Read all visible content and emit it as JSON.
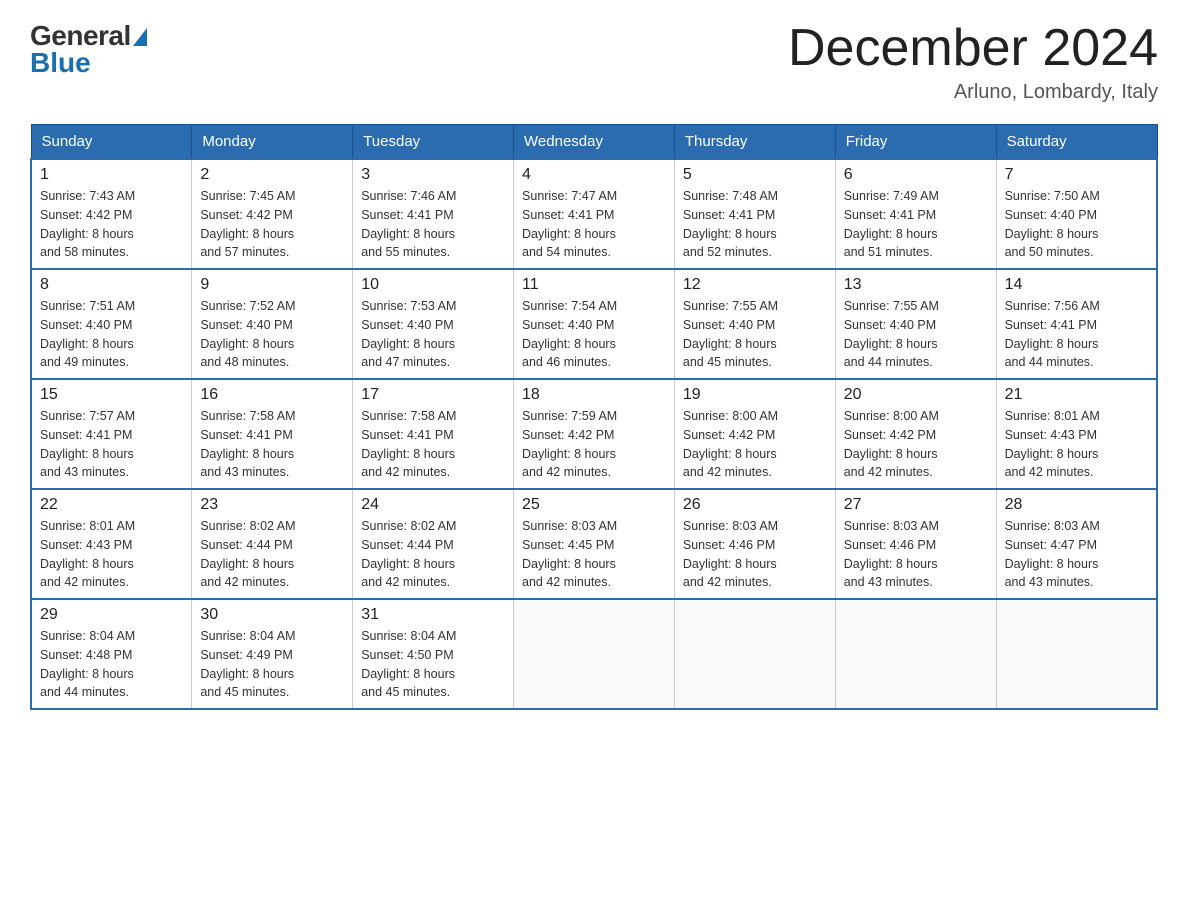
{
  "header": {
    "logo_general": "General",
    "logo_blue": "Blue",
    "month_title": "December 2024",
    "location": "Arluno, Lombardy, Italy"
  },
  "days_of_week": [
    "Sunday",
    "Monday",
    "Tuesday",
    "Wednesday",
    "Thursday",
    "Friday",
    "Saturday"
  ],
  "weeks": [
    [
      {
        "day": "1",
        "sunrise": "7:43 AM",
        "sunset": "4:42 PM",
        "daylight": "8 hours and 58 minutes."
      },
      {
        "day": "2",
        "sunrise": "7:45 AM",
        "sunset": "4:42 PM",
        "daylight": "8 hours and 57 minutes."
      },
      {
        "day": "3",
        "sunrise": "7:46 AM",
        "sunset": "4:41 PM",
        "daylight": "8 hours and 55 minutes."
      },
      {
        "day": "4",
        "sunrise": "7:47 AM",
        "sunset": "4:41 PM",
        "daylight": "8 hours and 54 minutes."
      },
      {
        "day": "5",
        "sunrise": "7:48 AM",
        "sunset": "4:41 PM",
        "daylight": "8 hours and 52 minutes."
      },
      {
        "day": "6",
        "sunrise": "7:49 AM",
        "sunset": "4:41 PM",
        "daylight": "8 hours and 51 minutes."
      },
      {
        "day": "7",
        "sunrise": "7:50 AM",
        "sunset": "4:40 PM",
        "daylight": "8 hours and 50 minutes."
      }
    ],
    [
      {
        "day": "8",
        "sunrise": "7:51 AM",
        "sunset": "4:40 PM",
        "daylight": "8 hours and 49 minutes."
      },
      {
        "day": "9",
        "sunrise": "7:52 AM",
        "sunset": "4:40 PM",
        "daylight": "8 hours and 48 minutes."
      },
      {
        "day": "10",
        "sunrise": "7:53 AM",
        "sunset": "4:40 PM",
        "daylight": "8 hours and 47 minutes."
      },
      {
        "day": "11",
        "sunrise": "7:54 AM",
        "sunset": "4:40 PM",
        "daylight": "8 hours and 46 minutes."
      },
      {
        "day": "12",
        "sunrise": "7:55 AM",
        "sunset": "4:40 PM",
        "daylight": "8 hours and 45 minutes."
      },
      {
        "day": "13",
        "sunrise": "7:55 AM",
        "sunset": "4:40 PM",
        "daylight": "8 hours and 44 minutes."
      },
      {
        "day": "14",
        "sunrise": "7:56 AM",
        "sunset": "4:41 PM",
        "daylight": "8 hours and 44 minutes."
      }
    ],
    [
      {
        "day": "15",
        "sunrise": "7:57 AM",
        "sunset": "4:41 PM",
        "daylight": "8 hours and 43 minutes."
      },
      {
        "day": "16",
        "sunrise": "7:58 AM",
        "sunset": "4:41 PM",
        "daylight": "8 hours and 43 minutes."
      },
      {
        "day": "17",
        "sunrise": "7:58 AM",
        "sunset": "4:41 PM",
        "daylight": "8 hours and 42 minutes."
      },
      {
        "day": "18",
        "sunrise": "7:59 AM",
        "sunset": "4:42 PM",
        "daylight": "8 hours and 42 minutes."
      },
      {
        "day": "19",
        "sunrise": "8:00 AM",
        "sunset": "4:42 PM",
        "daylight": "8 hours and 42 minutes."
      },
      {
        "day": "20",
        "sunrise": "8:00 AM",
        "sunset": "4:42 PM",
        "daylight": "8 hours and 42 minutes."
      },
      {
        "day": "21",
        "sunrise": "8:01 AM",
        "sunset": "4:43 PM",
        "daylight": "8 hours and 42 minutes."
      }
    ],
    [
      {
        "day": "22",
        "sunrise": "8:01 AM",
        "sunset": "4:43 PM",
        "daylight": "8 hours and 42 minutes."
      },
      {
        "day": "23",
        "sunrise": "8:02 AM",
        "sunset": "4:44 PM",
        "daylight": "8 hours and 42 minutes."
      },
      {
        "day": "24",
        "sunrise": "8:02 AM",
        "sunset": "4:44 PM",
        "daylight": "8 hours and 42 minutes."
      },
      {
        "day": "25",
        "sunrise": "8:03 AM",
        "sunset": "4:45 PM",
        "daylight": "8 hours and 42 minutes."
      },
      {
        "day": "26",
        "sunrise": "8:03 AM",
        "sunset": "4:46 PM",
        "daylight": "8 hours and 42 minutes."
      },
      {
        "day": "27",
        "sunrise": "8:03 AM",
        "sunset": "4:46 PM",
        "daylight": "8 hours and 43 minutes."
      },
      {
        "day": "28",
        "sunrise": "8:03 AM",
        "sunset": "4:47 PM",
        "daylight": "8 hours and 43 minutes."
      }
    ],
    [
      {
        "day": "29",
        "sunrise": "8:04 AM",
        "sunset": "4:48 PM",
        "daylight": "8 hours and 44 minutes."
      },
      {
        "day": "30",
        "sunrise": "8:04 AM",
        "sunset": "4:49 PM",
        "daylight": "8 hours and 45 minutes."
      },
      {
        "day": "31",
        "sunrise": "8:04 AM",
        "sunset": "4:50 PM",
        "daylight": "8 hours and 45 minutes."
      },
      null,
      null,
      null,
      null
    ]
  ],
  "labels": {
    "sunrise": "Sunrise:",
    "sunset": "Sunset:",
    "daylight": "Daylight:"
  }
}
